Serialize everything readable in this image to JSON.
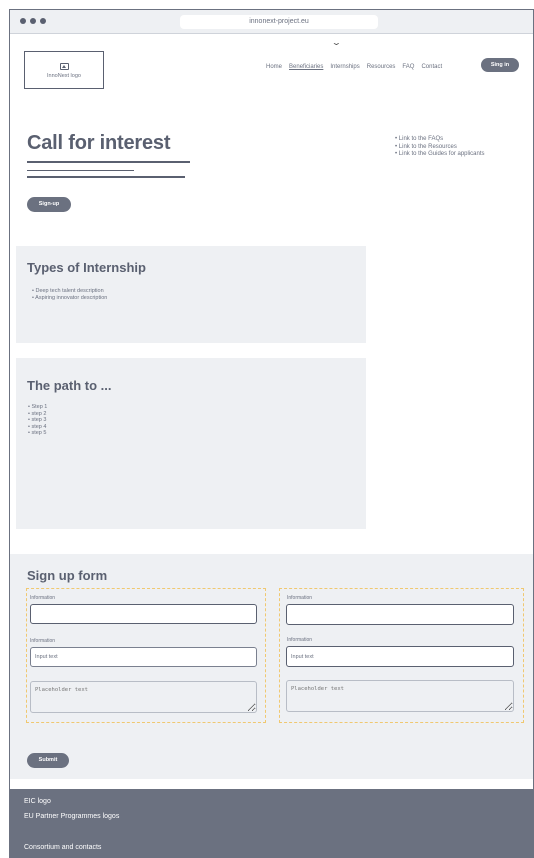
{
  "browser": {
    "url": "innonext-project.eu"
  },
  "header": {
    "logo_text": "InnoNext logo",
    "nav": [
      "Home",
      "Beneficiaries",
      "Internships",
      "Resources",
      "FAQ",
      "Contact"
    ],
    "signin_label": "Sing in"
  },
  "hero": {
    "title": "Call for interest",
    "signup_label": "Sign-up",
    "links": [
      "Link to the FAQs",
      "Link to the Resources",
      "Link to the Guides for applicants"
    ]
  },
  "types": {
    "title": "Types of Internship",
    "items": [
      "Deep tech talent description",
      "Aspiring innovator description"
    ]
  },
  "path": {
    "title": "The path to ...",
    "items": [
      "Step 1",
      "step 2",
      "step 3",
      "step 4",
      "step 5"
    ]
  },
  "form": {
    "title": "Sign up form",
    "left": {
      "label1": "Information",
      "value1": "",
      "label2": "Information",
      "value2": "Input text",
      "placeholder": "Placeholder text"
    },
    "right": {
      "label1": "Information",
      "value1": "",
      "label2": "Information",
      "value2": "Input text",
      "placeholder": "Placeholder text"
    },
    "submit_label": "Submit"
  },
  "footer": {
    "line1": "EIC logo",
    "line2": "EU Partner Programmes logos",
    "line3": "Consortium and contacts"
  },
  "colors": {
    "accent": "#6b7180",
    "section_bg": "#eef0f3",
    "dashed_border": "#f0c870"
  }
}
